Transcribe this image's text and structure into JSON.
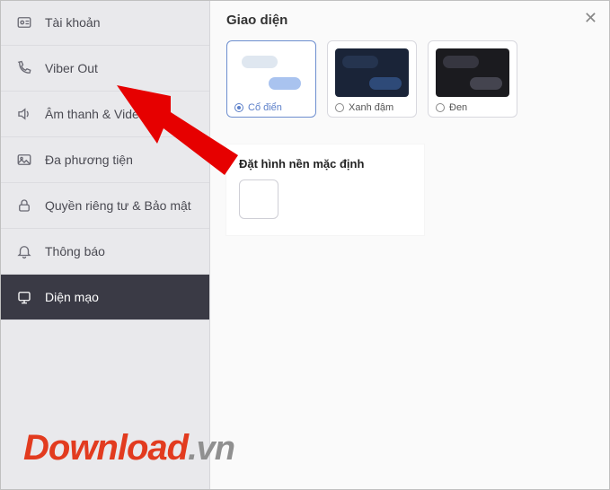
{
  "sidebar": {
    "items": [
      {
        "label": "Tài khoản",
        "icon": "account"
      },
      {
        "label": "Viber Out",
        "icon": "phone"
      },
      {
        "label": "Âm thanh & Video",
        "icon": "speaker"
      },
      {
        "label": "Đa phương tiện",
        "icon": "media"
      },
      {
        "label": "Quyền riêng tư & Bảo mật",
        "icon": "lock"
      },
      {
        "label": "Thông báo",
        "icon": "bell"
      },
      {
        "label": "Diện mạo",
        "icon": "appearance"
      }
    ],
    "activeIndex": 6
  },
  "main": {
    "section_title": "Giao diện",
    "themes": [
      {
        "label": "Cổ điển",
        "selected": true
      },
      {
        "label": "Xanh đậm",
        "selected": false
      },
      {
        "label": "Đen",
        "selected": false
      }
    ],
    "wallpaper_title": "Đặt hình nền mặc định"
  },
  "watermark": {
    "part1": "Download",
    "part2": ".vn"
  }
}
